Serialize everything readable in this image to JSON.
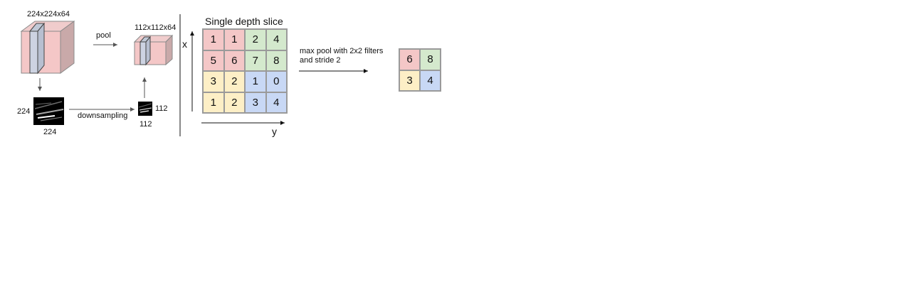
{
  "volume_in_label": "224x224x64",
  "volume_out_label": "112x112x64",
  "pool_label": "pool",
  "downsampling_label": "downsampling",
  "map_in_height": "224",
  "map_in_width": "224",
  "map_out_height": "112",
  "map_out_width": "112",
  "slice_title": "Single depth slice",
  "axis_x": "x",
  "axis_y": "y",
  "input_grid": [
    [
      {
        "v": "1",
        "c": "pink"
      },
      {
        "v": "1",
        "c": "pink"
      },
      {
        "v": "2",
        "c": "green"
      },
      {
        "v": "4",
        "c": "green"
      }
    ],
    [
      {
        "v": "5",
        "c": "pink"
      },
      {
        "v": "6",
        "c": "pink"
      },
      {
        "v": "7",
        "c": "green"
      },
      {
        "v": "8",
        "c": "green"
      }
    ],
    [
      {
        "v": "3",
        "c": "yellow"
      },
      {
        "v": "2",
        "c": "yellow"
      },
      {
        "v": "1",
        "c": "blue"
      },
      {
        "v": "0",
        "c": "blue"
      }
    ],
    [
      {
        "v": "1",
        "c": "yellow"
      },
      {
        "v": "2",
        "c": "yellow"
      },
      {
        "v": "3",
        "c": "blue"
      },
      {
        "v": "4",
        "c": "blue"
      }
    ]
  ],
  "maxpool_caption_line1": "max pool with 2x2 filters",
  "maxpool_caption_line2": "and stride 2",
  "output_grid": [
    [
      {
        "v": "6",
        "c": "pink"
      },
      {
        "v": "8",
        "c": "green"
      }
    ],
    [
      {
        "v": "3",
        "c": "yellow"
      },
      {
        "v": "4",
        "c": "blue"
      }
    ]
  ]
}
